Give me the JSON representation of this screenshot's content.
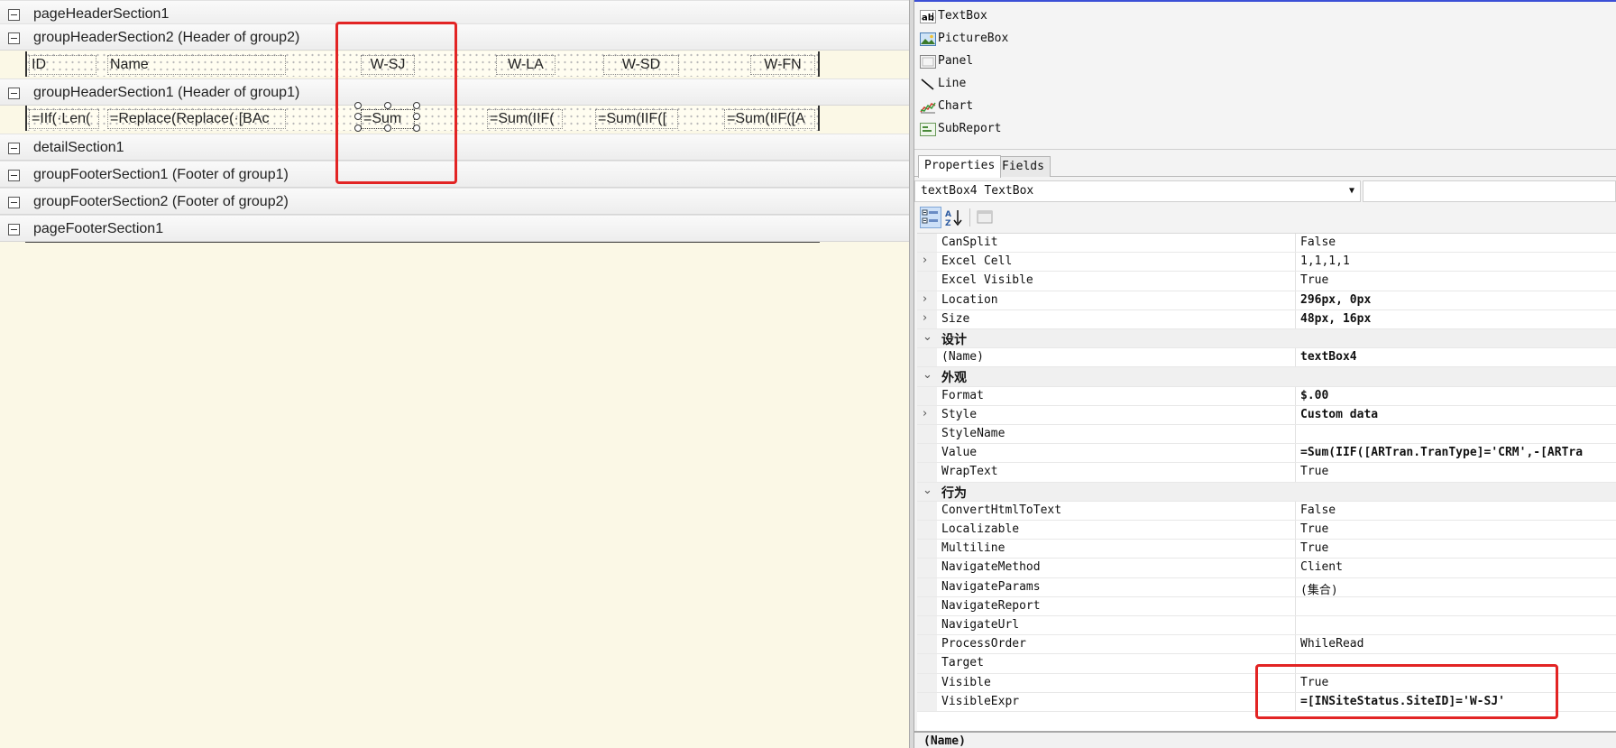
{
  "designer": {
    "sections": [
      {
        "id": "pageHeader",
        "title": "pageHeaderSection1"
      },
      {
        "id": "gh2",
        "title": "groupHeaderSection2 (Header of group2)"
      },
      {
        "id": "gh1",
        "title": "groupHeaderSection1 (Header of group1)"
      },
      {
        "id": "detail",
        "title": "detailSection1"
      },
      {
        "id": "gf1",
        "title": "groupFooterSection1 (Footer of group1)"
      },
      {
        "id": "gf2",
        "title": "groupFooterSection2 (Footer of group2)"
      },
      {
        "id": "pageFooter",
        "title": "pageFooterSection1"
      }
    ],
    "header_row": [
      "ID",
      "Name",
      "W-SJ",
      "W-LA",
      "W-SD",
      "W-FN"
    ],
    "data_row": [
      "=IIf(·Len(",
      "=Replace(Replace(·[BAc",
      "=Sum",
      "=Sum(IIF(",
      "=Sum(IIF([",
      "=Sum(IIF([A"
    ]
  },
  "toolbox": {
    "items": [
      {
        "label": "TextBox",
        "icon": "textbox-icon"
      },
      {
        "label": "PictureBox",
        "icon": "picturebox-icon"
      },
      {
        "label": "Panel",
        "icon": "panel-icon"
      },
      {
        "label": "Line",
        "icon": "line-icon"
      },
      {
        "label": "Chart",
        "icon": "chart-icon"
      },
      {
        "label": "SubReport",
        "icon": "subreport-icon"
      }
    ]
  },
  "properties": {
    "tabs": [
      "Properties",
      "Fields"
    ],
    "selected_object": "textBox4 TextBox",
    "rows": [
      {
        "name": "CanSplit",
        "value": "False"
      },
      {
        "name": "Excel Cell",
        "value": "1,1,1,1",
        "expandable": true
      },
      {
        "name": "Excel Visible",
        "value": "True"
      },
      {
        "name": "Location",
        "value": "296px, 0px",
        "expandable": true,
        "bold": true
      },
      {
        "name": "Size",
        "value": "48px, 16px",
        "expandable": true,
        "bold": true
      },
      {
        "name": "设计",
        "category": true
      },
      {
        "name": "(Name)",
        "value": "textBox4",
        "bold": true
      },
      {
        "name": "外观",
        "category": true
      },
      {
        "name": "Format",
        "value": "$.00",
        "bold": true
      },
      {
        "name": "Style",
        "value": "Custom data",
        "expandable": true,
        "bold": true
      },
      {
        "name": "StyleName",
        "value": ""
      },
      {
        "name": "Value",
        "value": "=Sum(IIF([ARTran.TranType]='CRM',-[ARTra",
        "bold": true
      },
      {
        "name": "WrapText",
        "value": "True"
      },
      {
        "name": "行为",
        "category": true
      },
      {
        "name": "ConvertHtmlToText",
        "value": "False"
      },
      {
        "name": "Localizable",
        "value": "True"
      },
      {
        "name": "Multiline",
        "value": "True"
      },
      {
        "name": "NavigateMethod",
        "value": "Client"
      },
      {
        "name": "NavigateParams",
        "value": "(集合)"
      },
      {
        "name": "NavigateReport",
        "value": ""
      },
      {
        "name": "NavigateUrl",
        "value": ""
      },
      {
        "name": "ProcessOrder",
        "value": "WhileRead"
      },
      {
        "name": "Target",
        "value": ""
      },
      {
        "name": "Visible",
        "value": "True"
      },
      {
        "name": "VisibleExpr",
        "value": "=[INSiteStatus.SiteID]='W-SJ'",
        "bold": true
      }
    ],
    "description_title": "(Name)"
  },
  "colors": {
    "highlight_red": "#e22424",
    "designer_bg": "#fbf8e6",
    "toolbox_accent": "#3b4fd6"
  }
}
